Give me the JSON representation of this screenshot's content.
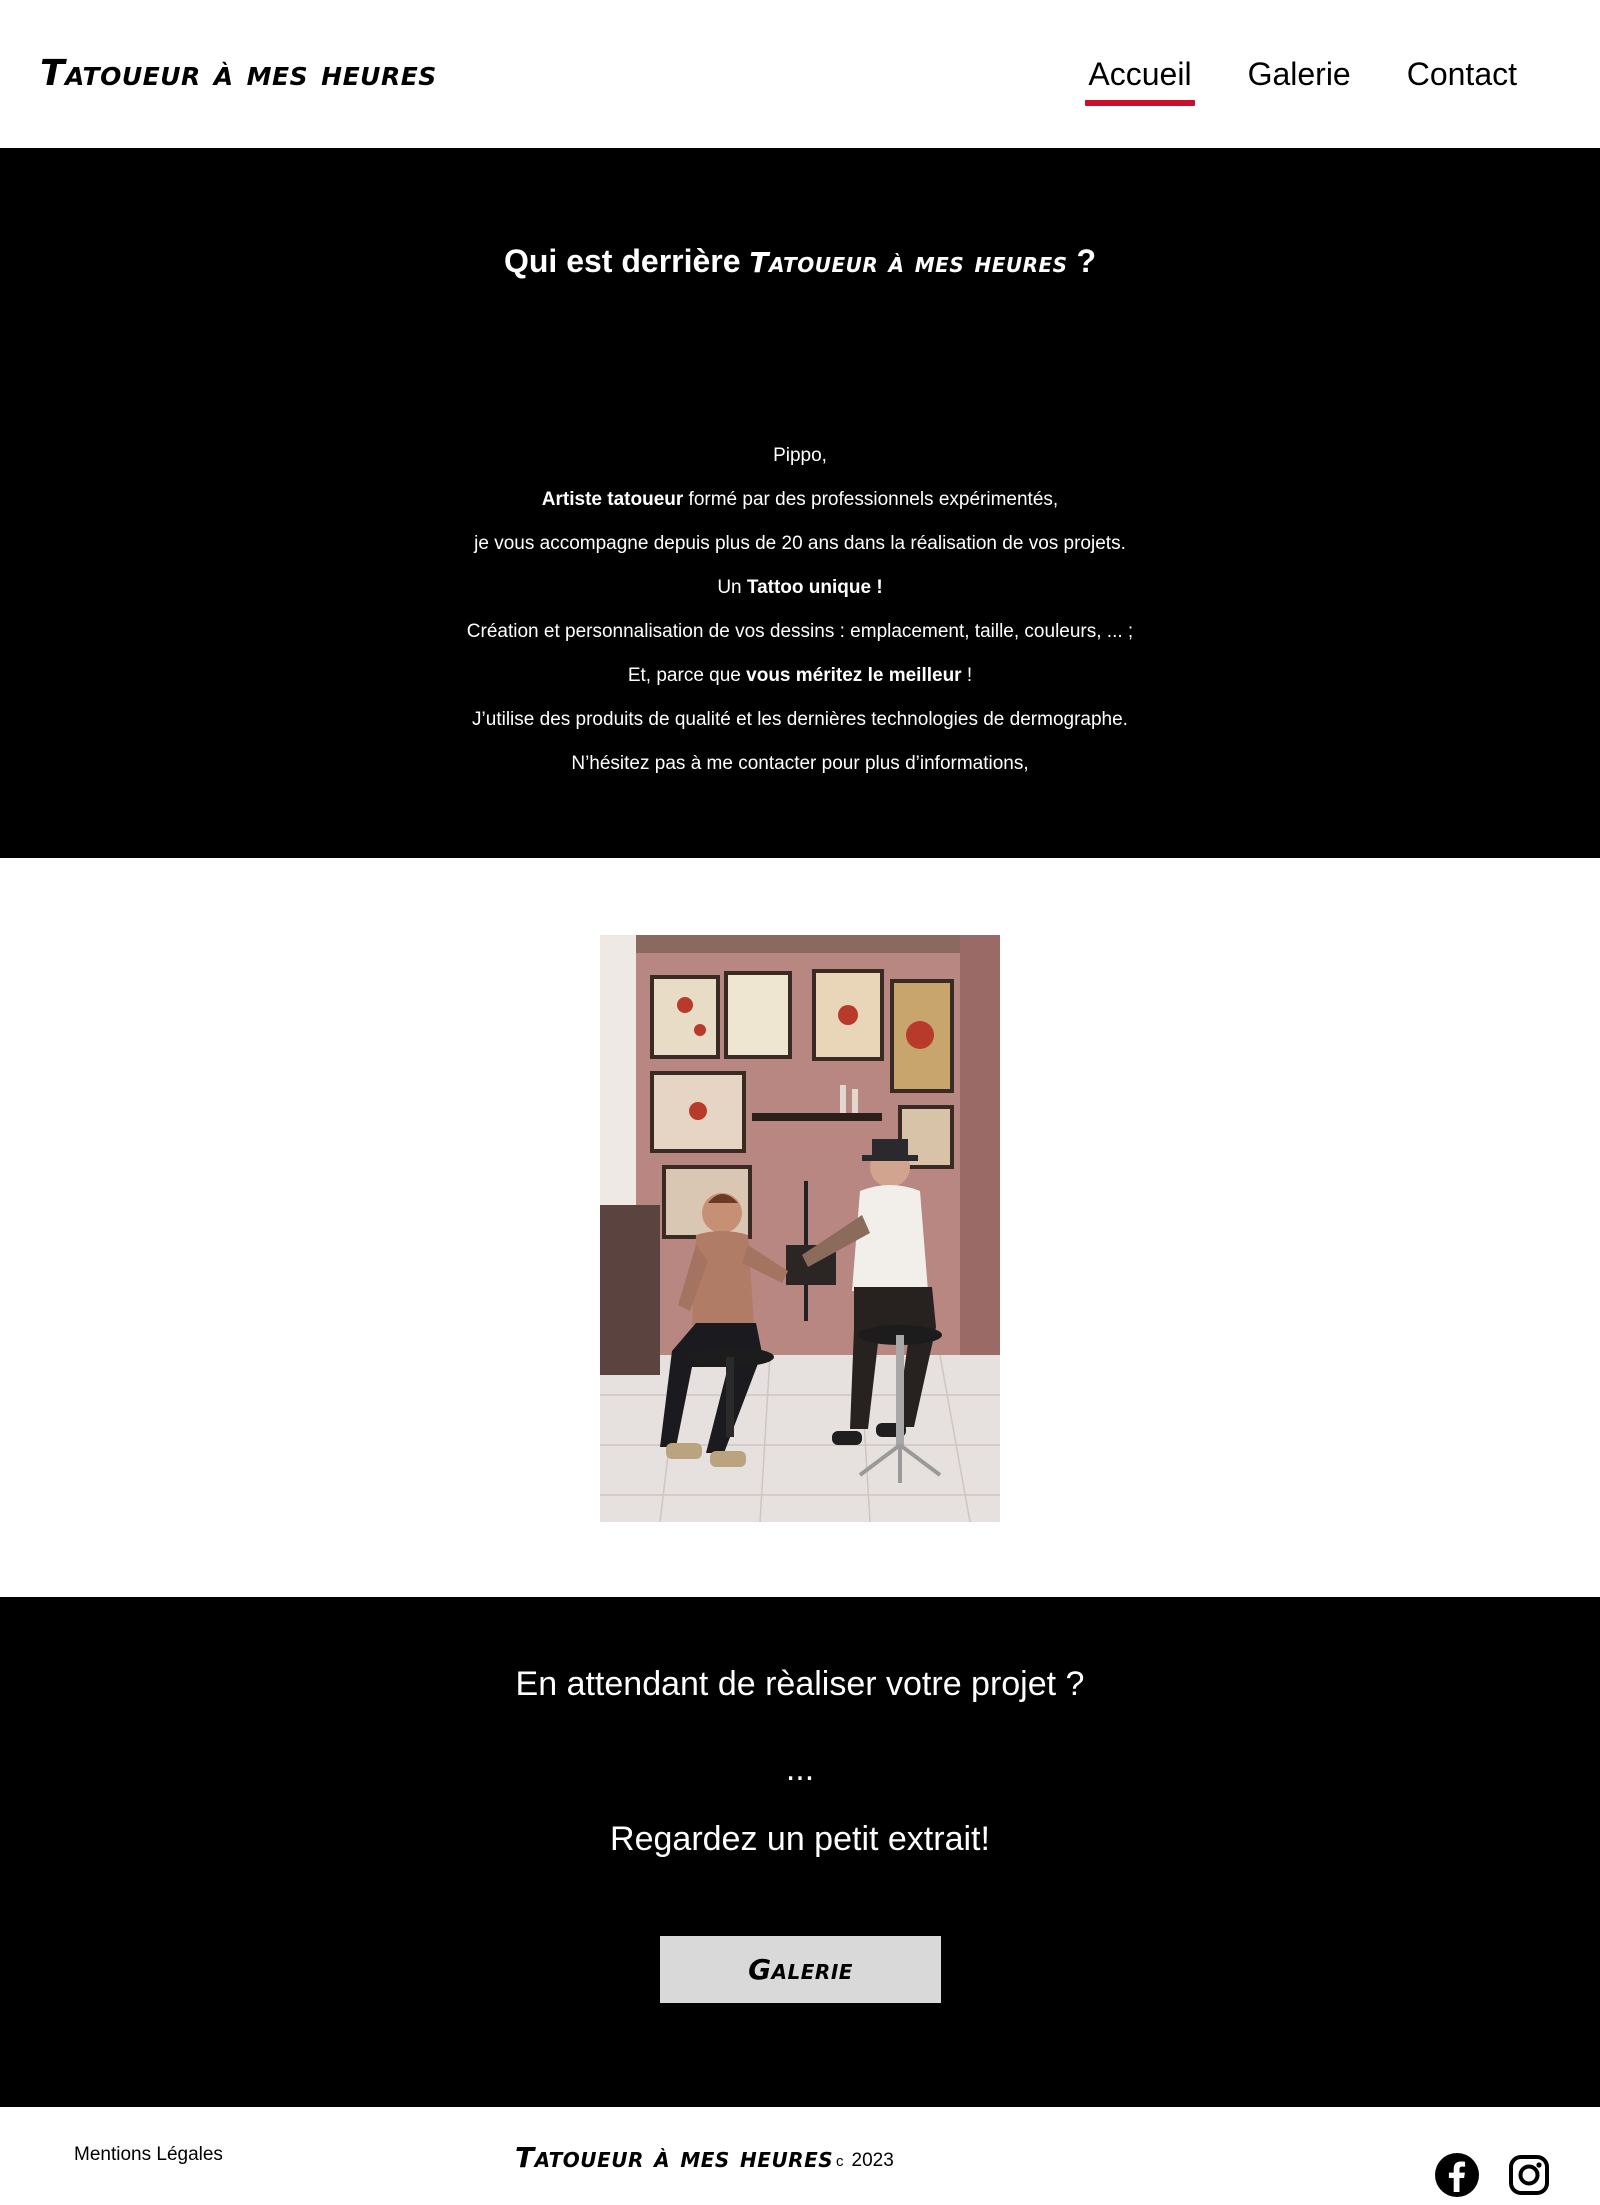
{
  "header": {
    "brand": "Tatoueur à mes heures",
    "nav": [
      {
        "label": "Accueil",
        "active": true
      },
      {
        "label": "Galerie",
        "active": false
      },
      {
        "label": "Contact",
        "active": false
      }
    ]
  },
  "about": {
    "title_prefix": "Qui est derrière",
    "title_brand": "Tatoueur à mes heures",
    "title_suffix": "?",
    "lines": {
      "l1": "Pippo,",
      "l2_bold": "Artiste tatoueur",
      "l2_rest": " formé par des professionnels expérimentés,",
      "l3": "je vous accompagne depuis plus de 20 ans dans la réalisation de vos projets.",
      "l4_pre": "Un ",
      "l4_bold": "Tattoo unique !",
      "l5": "Création et personnalisation de vos dessins : emplacement, taille, couleurs, ... ;",
      "l6_pre": "Et, parce que ",
      "l6_bold": "vous méritez le meilleur",
      "l6_post": " !",
      "l7": "J’utilise des produits de qualité et les dernières technologies de dermographe.",
      "l8": "N’hésitez pas à me contacter pour plus d’informations,"
    }
  },
  "cta": {
    "line1": "En attendant de rèaliser votre projet ?",
    "dots": "...",
    "line2": "Regardez un petit extrait!",
    "button": "Galerie"
  },
  "footer": {
    "legal": "Mentions Légales",
    "brand": "Tatoueur à mes heures",
    "copy_symbol": "c",
    "year": "2023",
    "social": [
      "facebook-icon",
      "instagram-icon"
    ]
  },
  "colors": {
    "accent": "#c8102e",
    "dark_bg": "#000000",
    "button_bg": "#d9d9d9"
  }
}
